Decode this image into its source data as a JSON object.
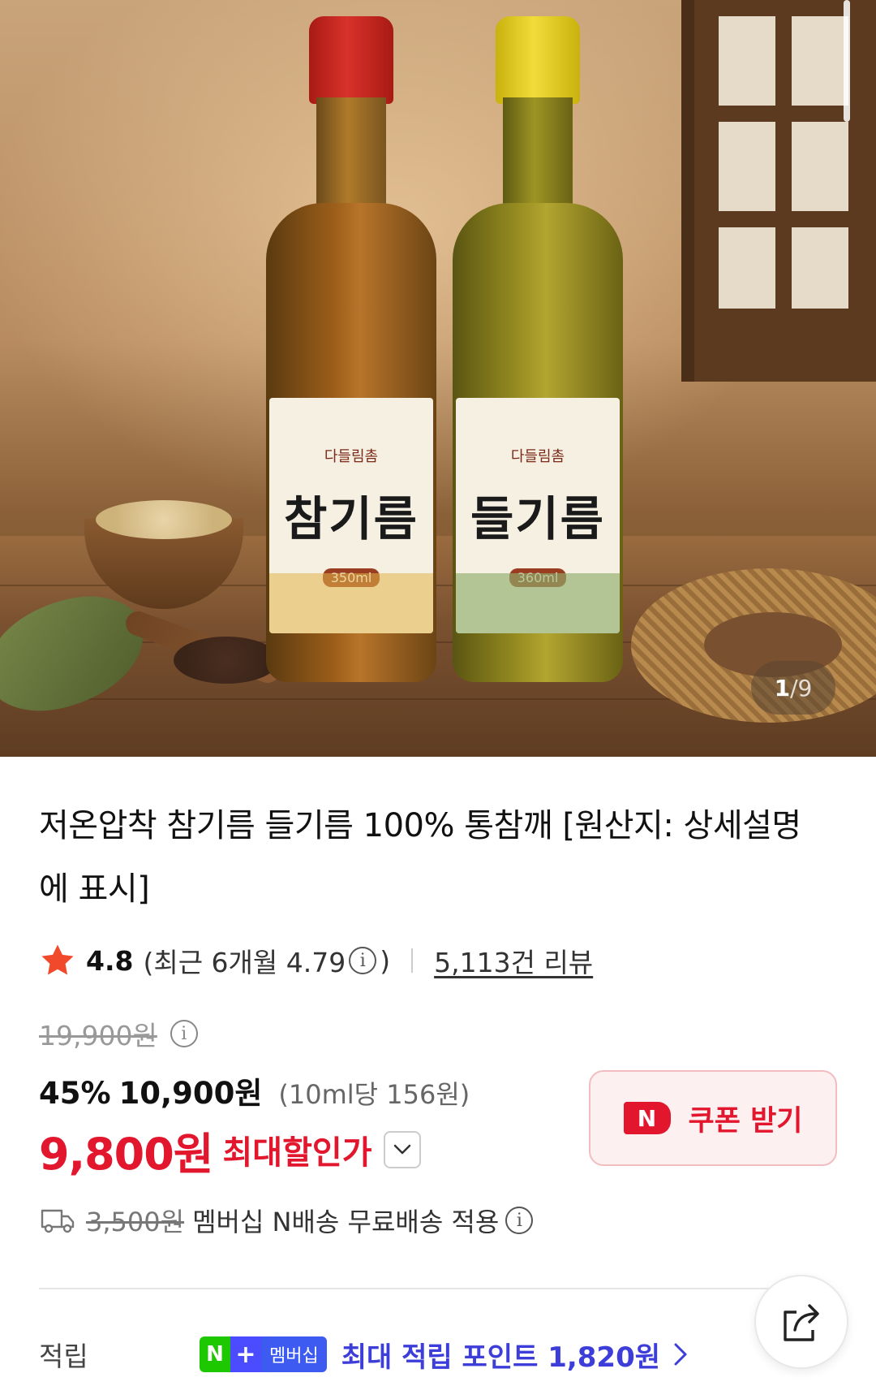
{
  "gallery": {
    "current": "1",
    "separator": "/",
    "total": "9",
    "bottles": [
      {
        "label_text": "참기름",
        "brand": "다들림촘",
        "volume": "350ml"
      },
      {
        "label_text": "들기름",
        "brand": "다들림촘",
        "volume": "360ml"
      }
    ]
  },
  "product": {
    "title": "저온압착 참기름 들기름 100% 통참깨 [원산지: 상세설명에 표시]"
  },
  "rating": {
    "score": "4.8",
    "recent_prefix": "(최근 6개월 4.79",
    "recent_suffix": ")",
    "reviews_link": "5,113건 리뷰"
  },
  "price": {
    "original": "19,900원",
    "discount": "45%",
    "sale": "10,900원",
    "unit": "(10ml당 156원)",
    "max_price": "9,800원",
    "max_label": "최대할인가"
  },
  "coupon": {
    "badge": "N",
    "label": "쿠폰 받기"
  },
  "shipping": {
    "fee": "3,500원",
    "text": "멤버십 N배송 무료배송 적용"
  },
  "points": {
    "label": "적립",
    "badge_n": "N",
    "badge_plus": "+",
    "badge_text": "멤버십",
    "text": "최대 적립 포인트 1,820원"
  },
  "colors": {
    "accent_red": "#e2172d",
    "membership_blue": "#3d3dd9",
    "naver_green": "#1ec800"
  },
  "icons": [
    "star-icon",
    "info-icon",
    "chevron-down-icon",
    "truck-icon",
    "share-icon",
    "chevron-right-icon"
  ]
}
